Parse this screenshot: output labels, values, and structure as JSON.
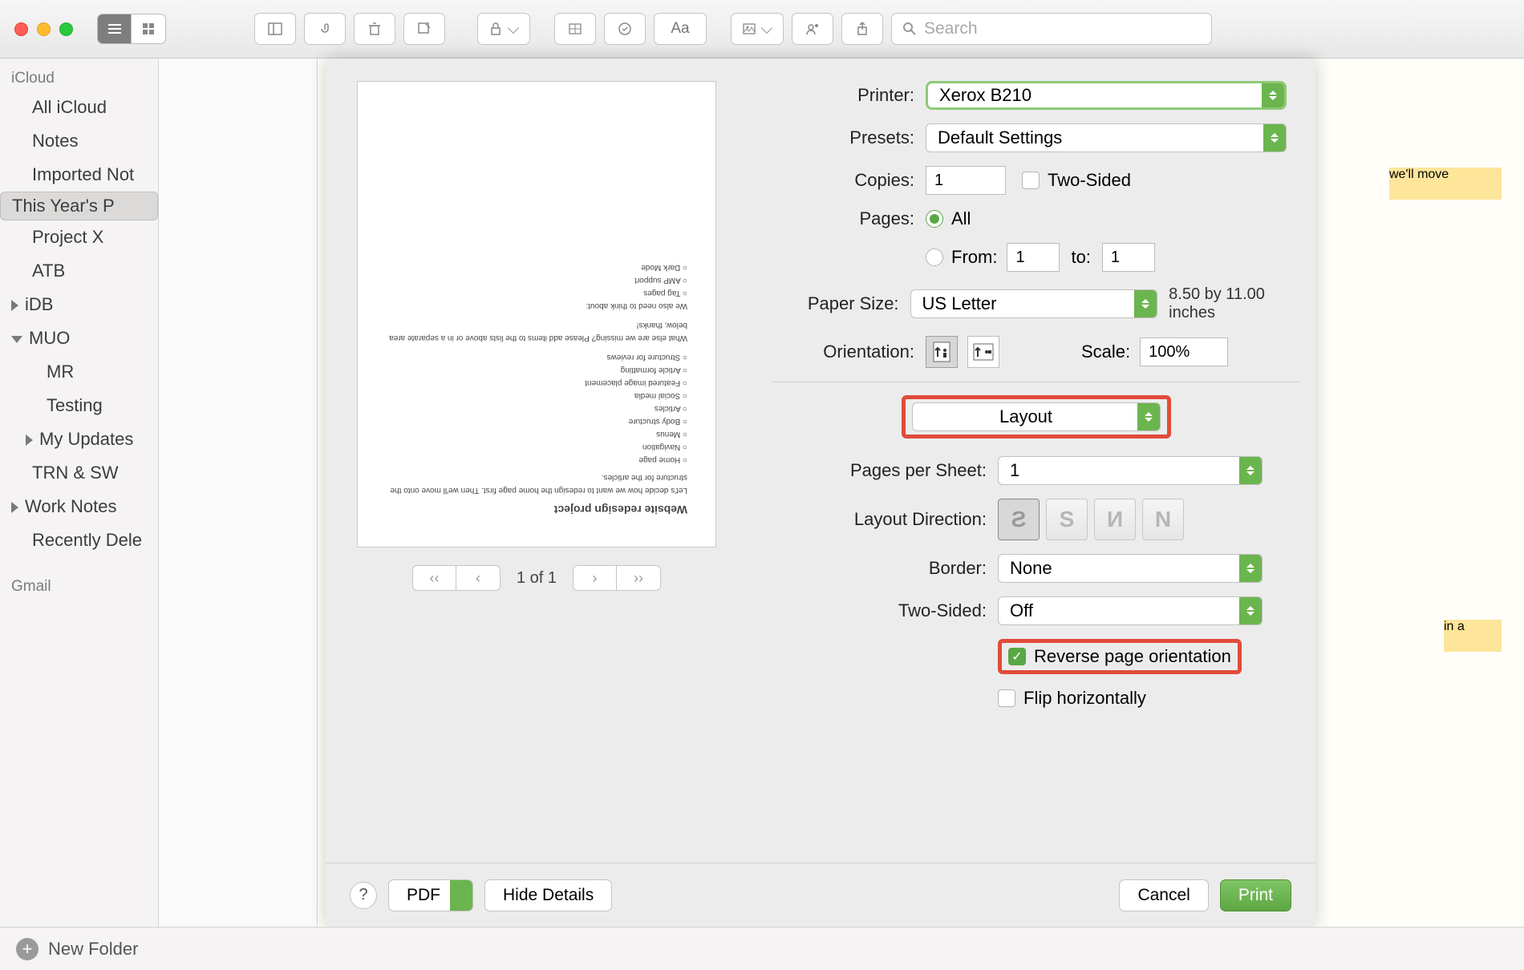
{
  "search": {
    "placeholder": "Search"
  },
  "sidebar": {
    "section1": "iCloud",
    "items": [
      "All iCloud",
      "Notes",
      "Imported Not",
      "This Year's P",
      "Project X",
      "ATB",
      "iDB",
      "MUO",
      "MR",
      "Testing",
      "My Updates",
      "TRN & SW",
      "Work Notes",
      "Recently Dele"
    ],
    "section2": "Gmail"
  },
  "note_hl1": "we'll move",
  "note_hl2": "in a",
  "preview": {
    "title": "Website redesign project",
    "body": "Let's decide how we want to redesign the home page first. Then we'll move onto the structure for the articles.",
    "bullets": [
      "Home page",
      "Navigation",
      "Menus",
      "Body structure",
      "Articles",
      "Social media",
      "Featured image placement",
      "Article formatting",
      "Structure for reviews"
    ],
    "q": "What else are we missing? Please add items to the lists above or in a separate area below, thanks!",
    "also": "We also need to think about:",
    "bullets2": [
      "Tag pages",
      "AMP support",
      "Dark Mode"
    ],
    "nav": "1 of 1"
  },
  "form": {
    "printer_lbl": "Printer:",
    "printer": "Xerox B210",
    "presets_lbl": "Presets:",
    "presets": "Default Settings",
    "copies_lbl": "Copies:",
    "copies": "1",
    "twosided": "Two-Sided",
    "pages_lbl": "Pages:",
    "pages_all": "All",
    "pages_from": "From:",
    "pages_to": "to:",
    "from_v": "1",
    "to_v": "1",
    "paper_lbl": "Paper Size:",
    "paper": "US Letter",
    "paper_dim": "8.50 by 11.00 inches",
    "orient_lbl": "Orientation:",
    "scale_lbl": "Scale:",
    "scale": "100%",
    "section": "Layout",
    "pps_lbl": "Pages per Sheet:",
    "pps": "1",
    "dir_lbl": "Layout Direction:",
    "border_lbl": "Border:",
    "border": "None",
    "ts_lbl": "Two-Sided:",
    "ts": "Off",
    "reverse": "Reverse page orientation",
    "flip": "Flip horizontally"
  },
  "buttons": {
    "pdf": "PDF",
    "hide": "Hide Details",
    "cancel": "Cancel",
    "print": "Print",
    "help": "?"
  },
  "footer": {
    "new": "New Folder"
  }
}
